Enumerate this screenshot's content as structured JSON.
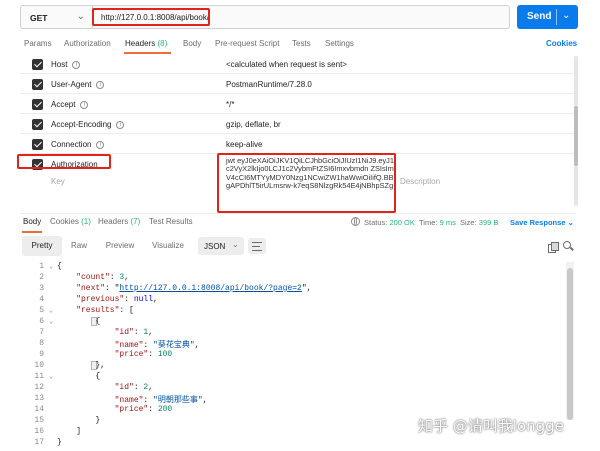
{
  "request": {
    "method": "GET",
    "url": "http://127.0.0.1:8008/api/book/",
    "send_label": "Send"
  },
  "request_tabs": [
    {
      "label": "Params",
      "count": ""
    },
    {
      "label": "Authorization",
      "count": ""
    },
    {
      "label": "Headers",
      "count": "(8)"
    },
    {
      "label": "Body",
      "count": ""
    },
    {
      "label": "Pre-request Script",
      "count": ""
    },
    {
      "label": "Tests",
      "count": ""
    },
    {
      "label": "Settings",
      "count": ""
    }
  ],
  "cookies_label": "Cookies",
  "headers": [
    {
      "key": "Host",
      "value": "<calculated when request is sent>"
    },
    {
      "key": "User-Agent",
      "value": "PostmanRuntime/7.28.0"
    },
    {
      "key": "Accept",
      "value": "*/*"
    },
    {
      "key": "Accept-Encoding",
      "value": "gzip, deflate, br"
    },
    {
      "key": "Connection",
      "value": "keep-alive"
    },
    {
      "key": "Authorization",
      "value": "jwt eyJ0eXAiOiJKV1QiLCJhbGciOiJIUzI1NiJ9.eyJ1c2VyX2lkIjo0LCJ1c2VybmFtZSI6Imxvbmdn ZSIsImV4cCI6MTYyMDY0Nzg1NCwiZW1haWwiOiIifQ.BBgAPDhlT5irULmsrw-k7eqS8NlzgRk54E4jNBhpSZg"
    }
  ],
  "placeholders": {
    "key": "Key",
    "description": "Description"
  },
  "response_tabs": [
    {
      "label": "Body",
      "count": ""
    },
    {
      "label": "Cookies",
      "count": "(1)"
    },
    {
      "label": "Headers",
      "count": "(7)"
    },
    {
      "label": "Test Results",
      "count": ""
    }
  ],
  "status": {
    "status_label": "Status:",
    "status_value": "200 OK",
    "time_label": "Time:",
    "time_value": "9 ms",
    "size_label": "Size:",
    "size_value": "399 B"
  },
  "save_response_label": "Save Response",
  "view_modes": [
    "Pretty",
    "Raw",
    "Preview",
    "Visualize"
  ],
  "format": "JSON",
  "line_numbers": [
    "1",
    "2",
    "3",
    "4",
    "5",
    "6",
    "7",
    "8",
    "9",
    "10",
    "11",
    "12",
    "13",
    "14",
    "15",
    "16",
    "17"
  ],
  "json_body": {
    "count_key": "\"count\"",
    "count_value": "3",
    "next_key": "\"next\"",
    "next_value": "http://127.0.0.1:8008/api/book/?page=2",
    "previous_key": "\"previous\"",
    "previous_value": "null",
    "results_key": "\"results\"",
    "id_key": "\"id\"",
    "name_key": "\"name\"",
    "price_key": "\"price\"",
    "items": [
      {
        "id": "1",
        "name": "\"葵花宝典\"",
        "price": "100"
      },
      {
        "id": "2",
        "name": "\"明朝那些事\"",
        "price": "200"
      }
    ]
  },
  "watermark": "知乎 @请叫我longge",
  "colors": {
    "send_button": "#097bed",
    "active_tab_underline": "#f26b3a",
    "highlight_box": "#e2231a",
    "status_ok": "#26b47f"
  }
}
